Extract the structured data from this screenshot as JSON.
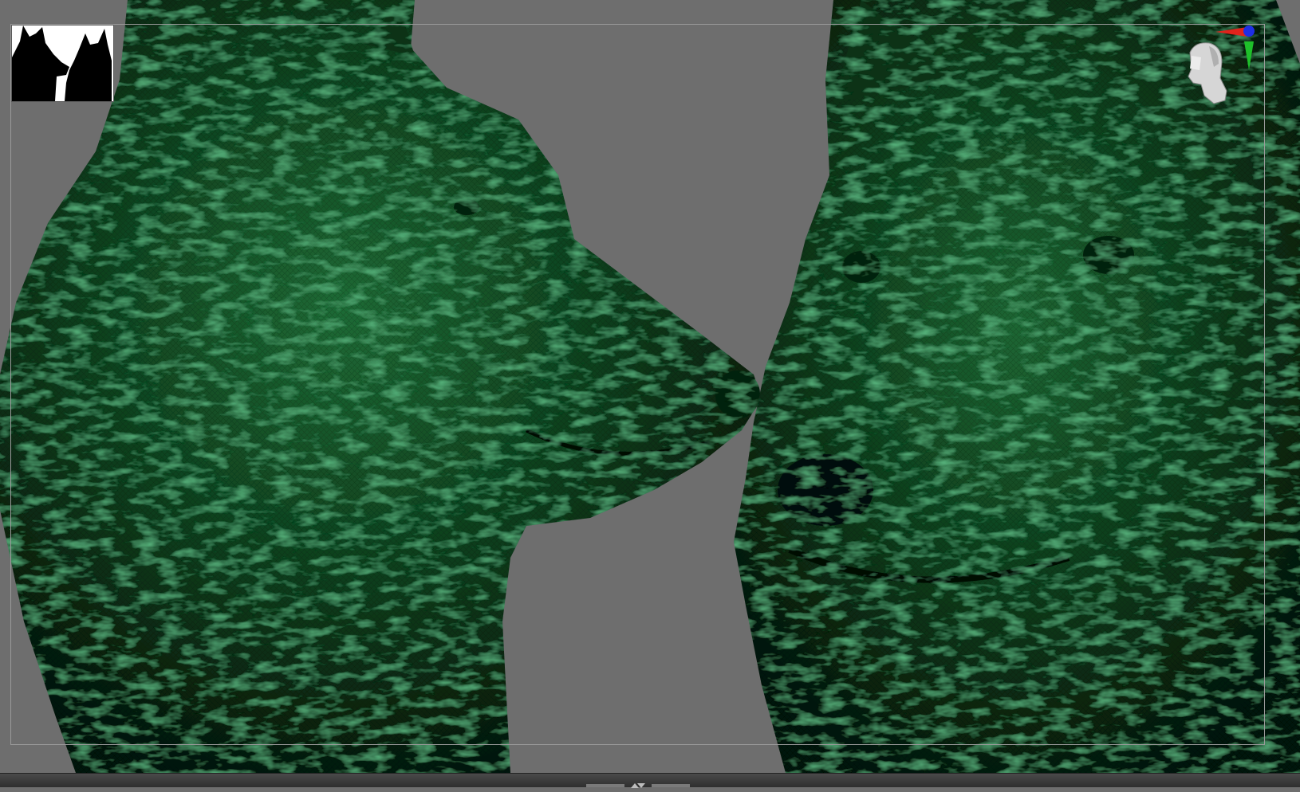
{
  "app": {
    "colors": {
      "viewport_bg": "#6e6e6e",
      "mesh_base": "#0d3d1c",
      "mesh_highlight": "#3fbf6a",
      "mesh_shadow": "#041307",
      "frame_guide": "#9a9a9a",
      "tray_bg": "#3a3a3a"
    }
  },
  "viewport": {
    "content": "two-sculpted-wolf-heads-nose-to-nose",
    "render_mode": "green-matcap-with-polyframe"
  },
  "silhouette_thumb": {
    "icon": "dual-wolf-silhouette-icon"
  },
  "nav_gizmo": {
    "icon": "head-orientation-gizmo-icon",
    "axes": [
      {
        "name": "x",
        "color": "#e0241c"
      },
      {
        "name": "y",
        "color": "#1ec02a"
      },
      {
        "name": "z",
        "color": "#1f2fe6"
      }
    ]
  },
  "bottom_tray": {
    "icon": "tray-collapse-arrows-icon"
  }
}
